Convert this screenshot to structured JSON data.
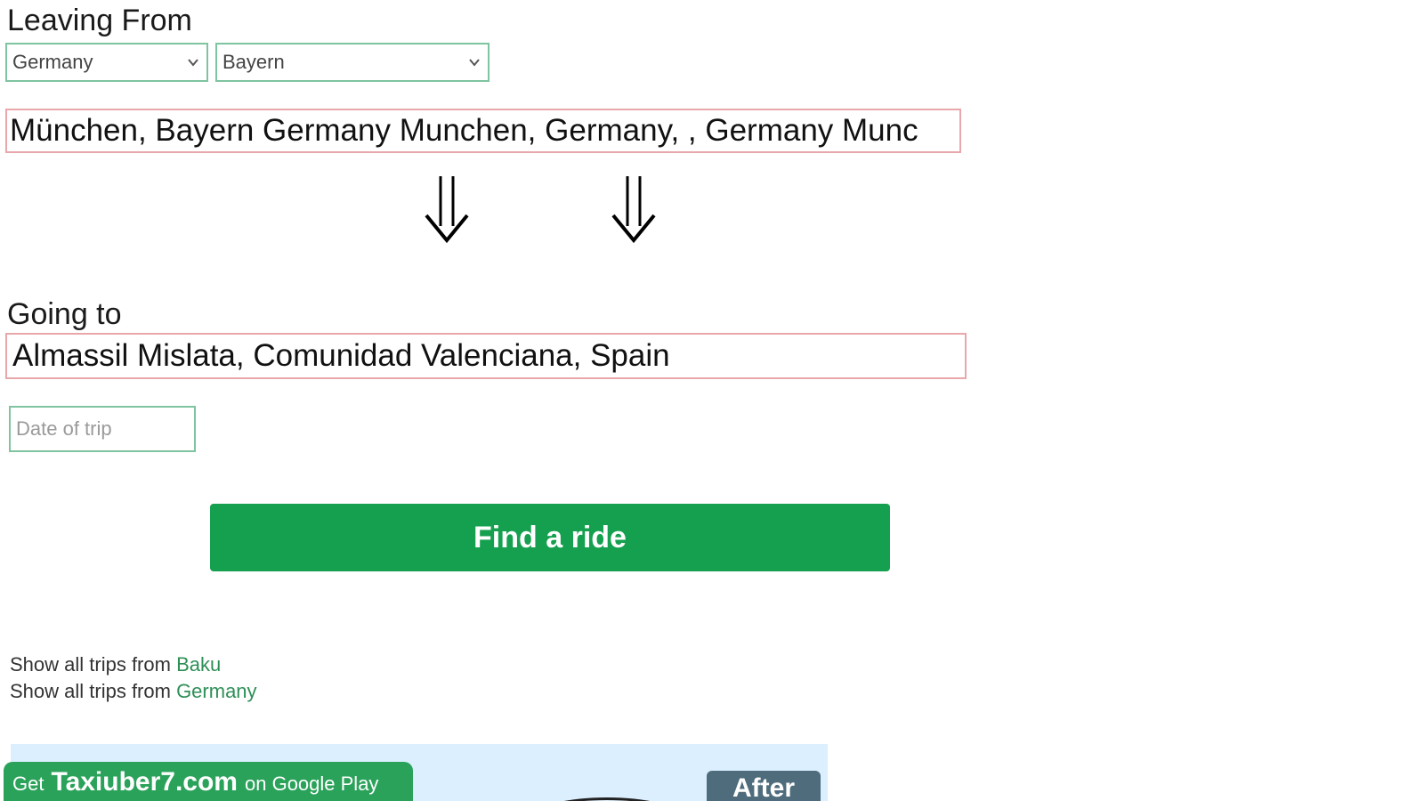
{
  "leaving": {
    "heading": "Leaving From",
    "country_select": "Germany",
    "region_select": "Bayern",
    "from_value": "München, Bayern Germany Munchen, Germany, , Germany Munc"
  },
  "going": {
    "heading": "Going to",
    "to_value": "Almassil Mislata, Comunidad Valenciana, Spain"
  },
  "date": {
    "placeholder": "Date of trip"
  },
  "find_button_label": "Find a ride",
  "trips": [
    {
      "prefix": "Show all trips from ",
      "link": "Baku"
    },
    {
      "prefix": "Show all trips from ",
      "link": "Germany"
    }
  ],
  "banner": {
    "get": "Get",
    "site": "Taxiuber7.com",
    "on": "on Google Play",
    "after": "After"
  },
  "icons": {
    "arrow": "double-down-arrow-icon",
    "chevron": "chevron-down-icon"
  },
  "colors": {
    "accent_green": "#14a04e",
    "link_green": "#2e8f57",
    "field_border_green": "#7fc4a0",
    "field_border_red": "#e8a7ab",
    "banner_bg": "#dcefff",
    "after_bg": "#4f6c7c"
  }
}
